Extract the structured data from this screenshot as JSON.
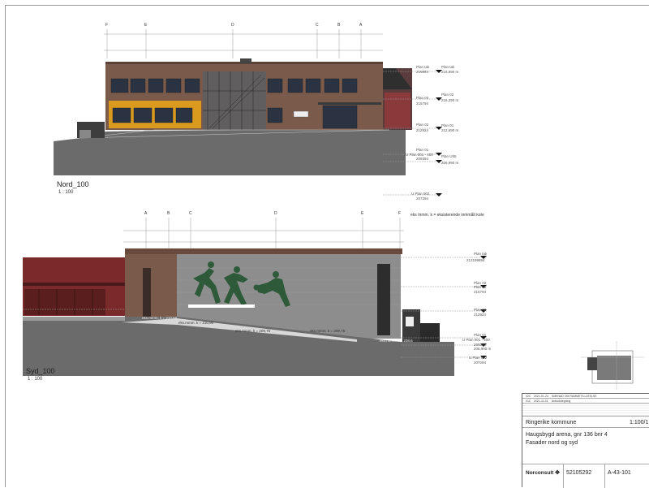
{
  "views": [
    {
      "title": "Nord_100",
      "scale": "1 : 100",
      "grid_axes": [
        "F",
        "E",
        "D",
        "C",
        "B",
        "A"
      ],
      "levels": [
        {
          "name": "Plan tak",
          "code": "219894",
          "value": "219,890 m"
        },
        {
          "name": "Plan 02",
          "code": "215794",
          "value": "216,290 m"
        },
        {
          "name": "Plan 01",
          "code": "212924",
          "value": "212,690 m"
        },
        {
          "name": "Plan 01",
          "code": "209394",
          "value": "Plan U01"
        },
        {
          "name": "U Plan 002",
          "code": "207294",
          "value": "206,990 m"
        }
      ],
      "level_labels_left": [
        "Plan tak",
        "Plan 03",
        "Plan 02",
        "Plan 01",
        "U Plan 001 - 400",
        "U Plan 002"
      ],
      "level_labels_right": [
        "Plan tak",
        "Plan 02",
        "Plan 01",
        "Plan U55"
      ],
      "level_values_right": [
        "219,890 m",
        "216,290 m",
        "212,690 m",
        "206,990 m"
      ]
    },
    {
      "title": "Syd_100",
      "scale": "1 : 100",
      "grid_axes": [
        "A",
        "B",
        "C",
        "D",
        "E",
        "F"
      ],
      "note": "eks mmm. k = eksisterende inmmålt kote",
      "levels_labels": [
        "Plan tak",
        "Plan 02",
        "Plan 01",
        "Plan 02",
        "Plan 01",
        "U Plan 001 - 400",
        "U Plan 002"
      ],
      "levels_codes": [
        "212199894",
        "215794",
        "212924",
        "209394",
        "207294"
      ],
      "levels_values": [
        "206,990 m"
      ],
      "spot_levels": [
        "eks.mmm. k = 210,66",
        "eks.mmm. k = 210,90",
        "eks.mmm. k = 209,75",
        "eks.mmm. k = 209,75",
        "eks.mmm. k = 208,6"
      ]
    }
  ],
  "title_block": {
    "rev1_code": "02C",
    "rev1_date": "2021-01-24",
    "rev1_desc": "SØKNAD OM RAMMETILLATELSE",
    "rev2_code": "01C",
    "rev2_date": "2021-11-01",
    "rev2_desc": "Anbudstegning",
    "client": "Ringerike kommune",
    "scale": "1:100/1",
    "project": "Haugsbygd arena, gnr 136 bnr 4",
    "drawing_title": "Fasader nord og syd",
    "company": "Norconsult",
    "project_number": "52105292",
    "drawing_number": "A-43-101"
  },
  "colors": {
    "brick": "#7a5a4a",
    "wall_gray": "#8d8d8d",
    "ground": "#6b6b6b",
    "red_building": "#7a2a2a",
    "yellow_panel": "#d99a1e",
    "mural_green": "#2e5a3a"
  }
}
